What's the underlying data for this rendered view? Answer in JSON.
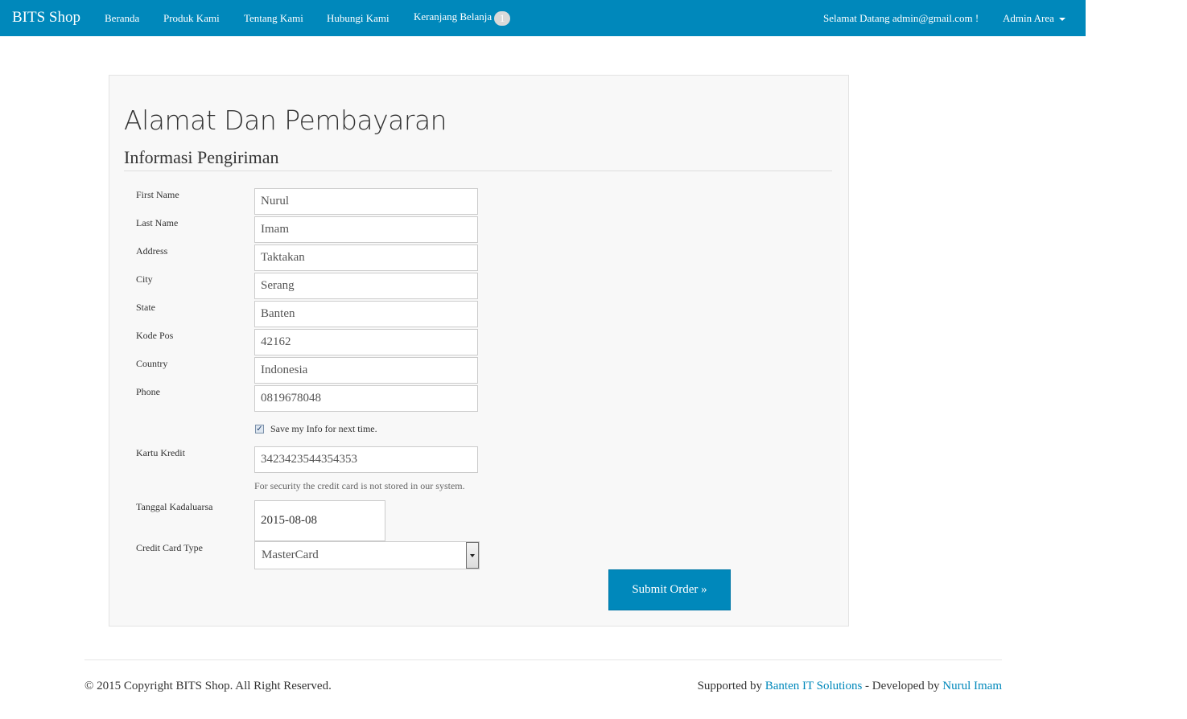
{
  "navbar": {
    "brand": "BITS Shop",
    "links": [
      "Beranda",
      "Produk Kami",
      "Tentang Kami",
      "Hubungi Kami"
    ],
    "cart_label": "Keranjang Belanja",
    "cart_count": "1",
    "welcome": "Selamat Datang admin@gmail.com !",
    "admin_label": "Admin Area"
  },
  "form": {
    "title": "Alamat Dan Pembayaran",
    "section": "Informasi Pengiriman",
    "fields": [
      {
        "label": "First Name",
        "value": "Nurul"
      },
      {
        "label": "Last Name",
        "value": "Imam"
      },
      {
        "label": "Address",
        "value": "Taktakan"
      },
      {
        "label": "City",
        "value": "Serang"
      },
      {
        "label": "State",
        "value": "Banten"
      },
      {
        "label": "Kode Pos",
        "value": "42162"
      },
      {
        "label": "Country",
        "value": "Indonesia"
      },
      {
        "label": "Phone",
        "value": "0819678048"
      }
    ],
    "save_info_label": "Save my Info for next time.",
    "save_info_checked": true,
    "card_label": "Kartu Kredit",
    "card_value": "3423423544354353",
    "card_help": "For security the credit card is not stored in our system.",
    "expiry_label": "Tanggal Kadaluarsa",
    "expiry_value": "2015-08-08",
    "card_type_label": "Credit Card Type",
    "card_type_value": "MasterCard",
    "submit_label": "Submit Order »"
  },
  "footer": {
    "copyright": "© 2015 Copyright BITS Shop. All Right Reserved.",
    "supported_prefix": "Supported by ",
    "supporter": "Banten IT Solutions",
    "developed_prefix": " - Developed by ",
    "developer": "Nurul Imam",
    "link_color": "#0088bb"
  },
  "colors": {
    "primary": "#0088bb",
    "badge": "#d9d9d9",
    "panel_bg": "#f8f8f8"
  }
}
